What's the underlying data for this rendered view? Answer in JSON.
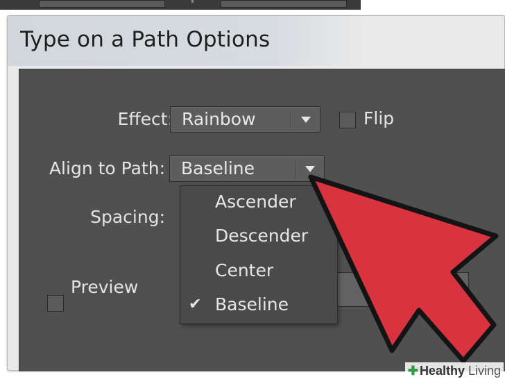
{
  "dialog": {
    "title": "Type on a Path Options"
  },
  "fields": {
    "effect": {
      "label": "Effect:",
      "value": "Rainbow"
    },
    "flip": {
      "label": "Flip",
      "checked": false
    },
    "align": {
      "label": "Align to Path:",
      "value": "Baseline"
    },
    "spacing": {
      "label": "Spacing:"
    },
    "preview": {
      "label": "Preview",
      "checked": false
    }
  },
  "dropdown": {
    "items": [
      {
        "label": "Ascender",
        "selected": false
      },
      {
        "label": "Descender",
        "selected": false
      },
      {
        "label": "Center",
        "selected": false
      },
      {
        "label": "Baseline",
        "selected": true
      }
    ],
    "check_glyph": "✔"
  },
  "pointer": {
    "color": "#d93340",
    "icon": "arrow-pointer-icon"
  },
  "watermark": {
    "plus": "✚",
    "brand_bold": "Healthy",
    "brand_light": " Living"
  }
}
